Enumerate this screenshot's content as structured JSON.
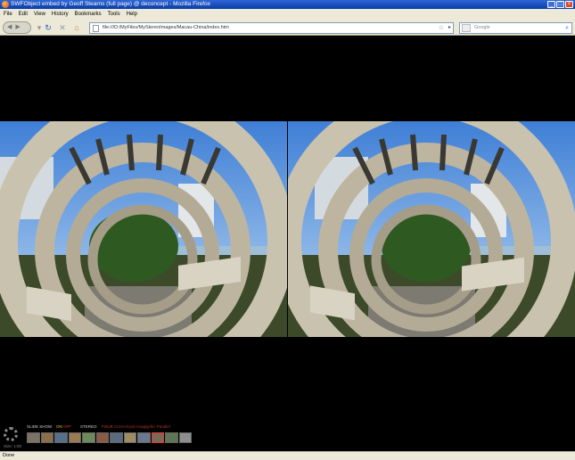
{
  "window": {
    "title": "SWFObject embed by Geoff Stearns (full page) @ deconcept - Mozilla Firefox",
    "controls": [
      "_",
      "□",
      "×"
    ]
  },
  "menu": {
    "items": [
      "File",
      "Edit",
      "View",
      "History",
      "Bookmarks",
      "Tools",
      "Help"
    ]
  },
  "nav": {
    "url": "file:///D:/MyFiles/MyStereoImages/Macau-China/index.htm",
    "search_placeholder": "Google"
  },
  "viewer": {
    "image_alt": "Stereo pair of concrete ring arches over a garden bench walkway",
    "zoom": "Size: 1:00",
    "slide_show_label": "SLIDE SHOW",
    "slide_on": "ON",
    "slide_off": "OFF",
    "stereo_label": "STEREO",
    "stereo_mode": "FOUR",
    "stereo_modes": "Cross-Eyed Anaglyphic Parallel",
    "thumbnail_count": 12,
    "selected_thumb": 10
  },
  "status": {
    "text": "Done"
  },
  "colors": {
    "titlebar": "#0a3ea8",
    "chrome": "#ece9d8",
    "accent_on": "#e8c23a",
    "accent_off": "#d03a2a"
  }
}
